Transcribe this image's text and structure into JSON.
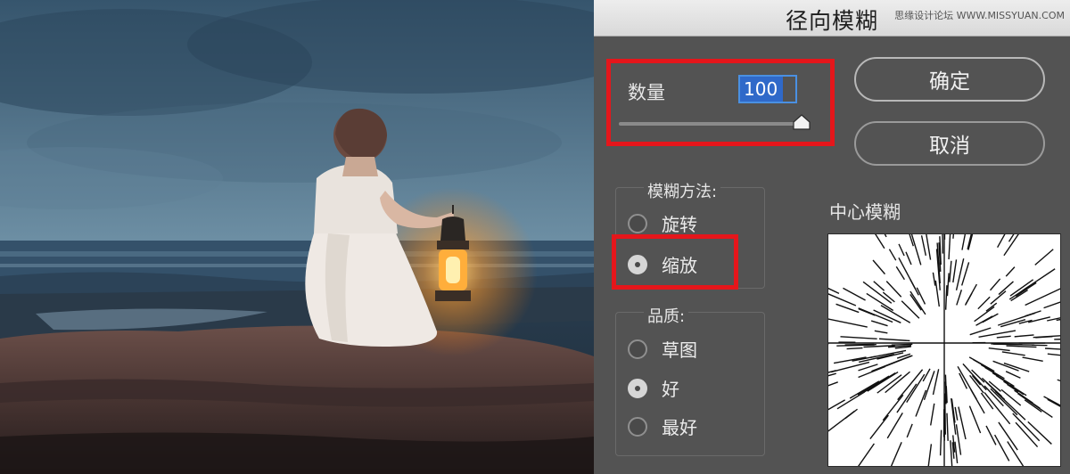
{
  "dialog": {
    "title": "径向模糊",
    "watermark": "思缘设计论坛 WWW.MISSYUAN.COM",
    "amount": {
      "label": "数量",
      "value": "100",
      "fraction": 1.0
    },
    "buttons": {
      "ok": "确定",
      "cancel": "取消"
    },
    "blur_method": {
      "legend": "模糊方法:",
      "options": [
        "旋转",
        "缩放"
      ],
      "selected": "缩放"
    },
    "quality": {
      "legend": "品质:",
      "options": [
        "草图",
        "好",
        "最好"
      ],
      "selected": "好"
    },
    "center_label": "中心模糊"
  },
  "colors": {
    "dialog_bg": "#535353",
    "titlebar_bg": "#e3e3e3",
    "annotation_red": "#e5161b",
    "input_focus": "#4a90e2"
  },
  "icons": {
    "slider_thumb": "slider-thumb-icon",
    "preview": "zoom-blur-preview-icon"
  }
}
